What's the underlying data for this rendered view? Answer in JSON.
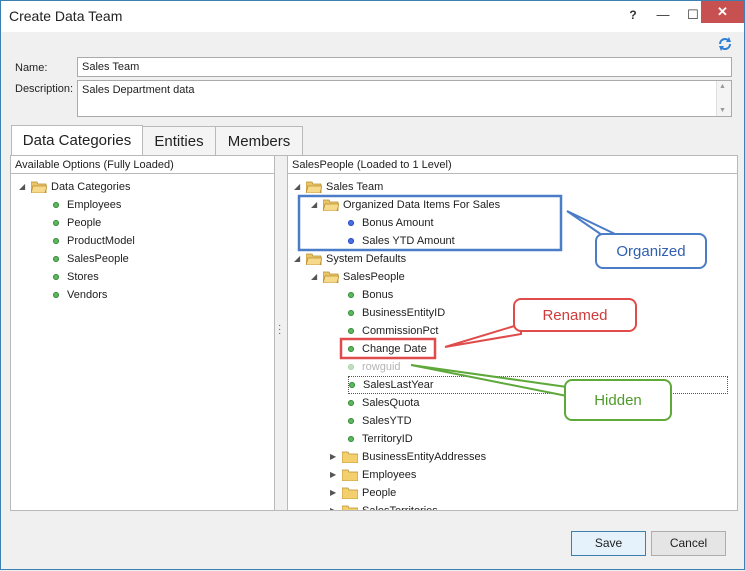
{
  "window": {
    "title": "Create Data Team",
    "help": "?",
    "minimize": "—",
    "maximize": "☐",
    "close": "✕"
  },
  "form": {
    "name_label": "Name:",
    "name_value": "Sales Team",
    "description_label": "Description:",
    "description_value": "Sales Department data"
  },
  "tabs": [
    {
      "label": "Data Categories",
      "active": true
    },
    {
      "label": "Entities",
      "active": false
    },
    {
      "label": "Members",
      "active": false
    }
  ],
  "left_pane": {
    "header": "Available Options (Fully Loaded)",
    "root": "Data Categories",
    "items": [
      "Employees",
      "People",
      "ProductModel",
      "SalesPeople",
      "Stores",
      "Vendors"
    ]
  },
  "right_pane": {
    "header": "SalesPeople (Loaded to 1 Level)",
    "sales_team": "Sales Team",
    "organized_folder": "Organized Data Items For Sales",
    "organized_items": [
      "Bonus Amount",
      "Sales YTD Amount"
    ],
    "system_defaults": "System Defaults",
    "salespeople": "SalesPeople",
    "fields": [
      "Bonus",
      "BusinessEntityID",
      "CommissionPct",
      "Change Date",
      "rowguid",
      "SalesLastYear",
      "SalesQuota",
      "SalesYTD",
      "TerritoryID"
    ],
    "subfolders": [
      "BusinessEntityAddresses",
      "Employees",
      "People",
      "SalesTerritories"
    ]
  },
  "callouts": {
    "organized": "Organized",
    "renamed": "Renamed",
    "hidden": "Hidden"
  },
  "colors": {
    "organized": "#4a7cc7",
    "renamed": "#e04b4b",
    "hidden": "#5fa83a"
  },
  "buttons": {
    "save": "Save",
    "cancel": "Cancel"
  }
}
